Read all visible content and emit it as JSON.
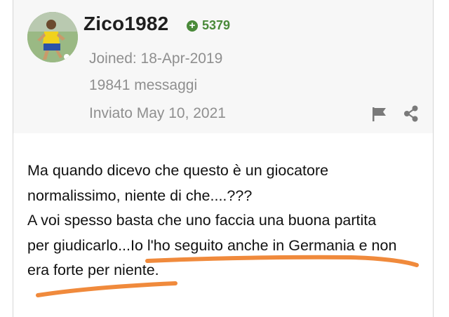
{
  "author": {
    "username": "Zico1982",
    "reputation": "5379",
    "joined": "Joined: 18-Apr-2019",
    "messages": "19841 messaggi"
  },
  "post": {
    "date": "Inviato May 10, 2021",
    "lines": [
      "Ma quando dicevo che questo è un giocatore",
      "normalissimo, niente di che....???",
      "A voi spesso basta che uno faccia una buona partita",
      "per giudicarlo...Io l'ho seguito anche in Germania e non",
      "era forte per niente."
    ]
  },
  "icons": {
    "reputation": "plus-circle-icon",
    "report": "flag-icon",
    "share": "share-icon"
  },
  "colors": {
    "reputation": "#4a8a3a",
    "annotation": "#f08a3c",
    "meta_text": "#8f8f8f"
  }
}
